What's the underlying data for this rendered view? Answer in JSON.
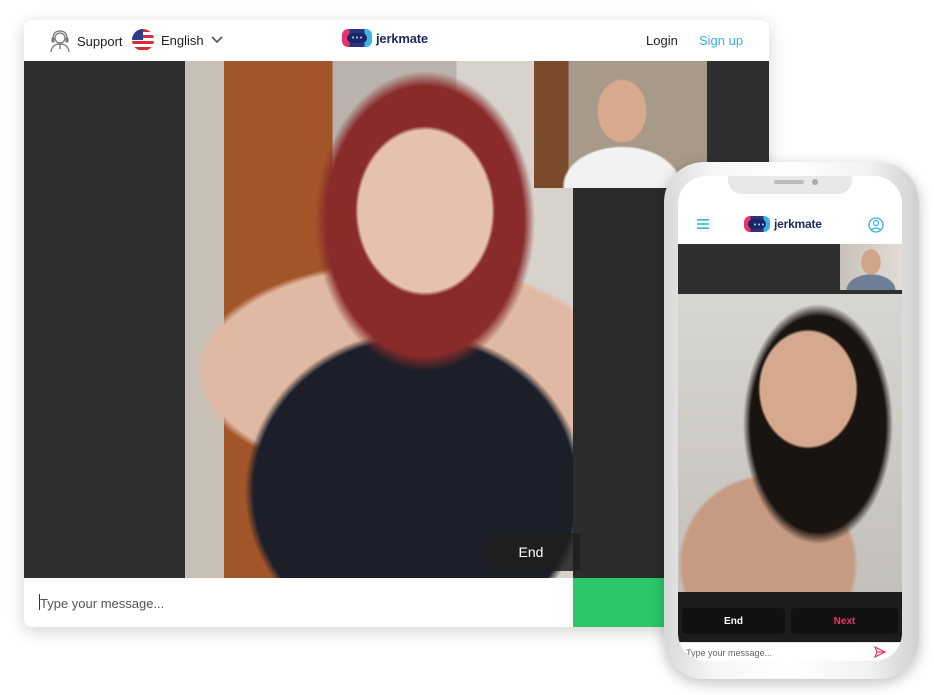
{
  "desktop": {
    "header": {
      "support_label": "Support",
      "language_label": "English",
      "logo_text": "jerkmate",
      "login_label": "Login",
      "signup_label": "Sign up"
    },
    "controls": {
      "end_label": "End"
    },
    "chat": {
      "placeholder": "Type your message..."
    }
  },
  "phone": {
    "header": {
      "logo_text": "jerkmate"
    },
    "controls": {
      "end_label": "End",
      "next_label": "Next"
    },
    "chat": {
      "placeholder": "Type your message..."
    }
  },
  "colors": {
    "accent_blue": "#3ab0e0",
    "accent_pink": "#e8336b",
    "green": "#2bc769",
    "dark": "#2f2f2f"
  },
  "icons": [
    "support-agent-icon",
    "us-flag-icon",
    "chevron-down-icon",
    "jerkmate-logo-icon",
    "hamburger-menu-icon",
    "user-account-icon",
    "send-icon"
  ]
}
